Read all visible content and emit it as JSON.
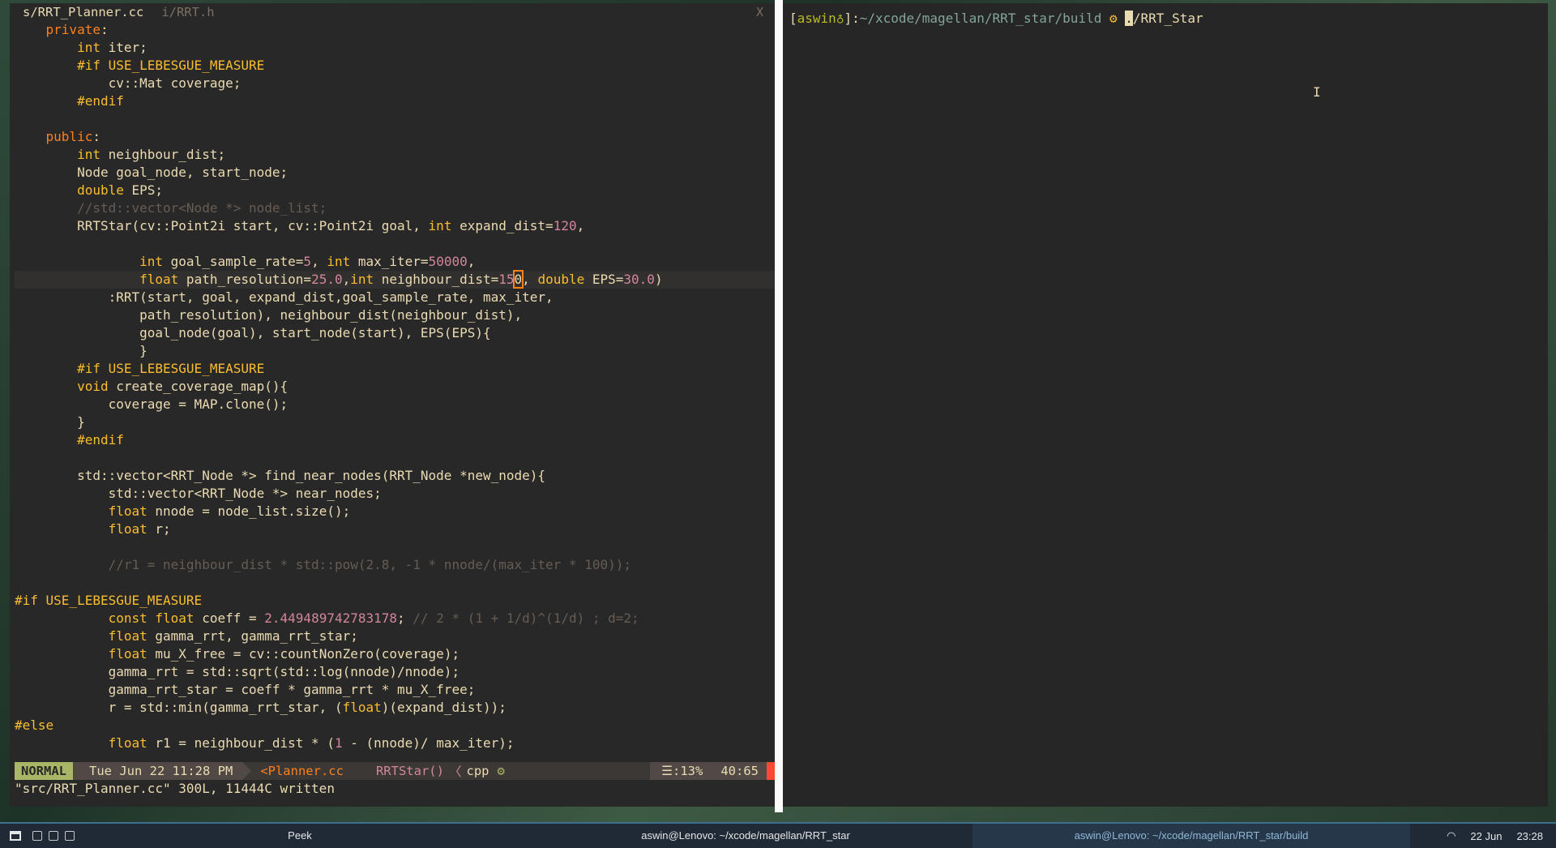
{
  "editor": {
    "tabs": [
      "s/RRT_Planner.cc",
      "i/RRT.h"
    ],
    "close_label": "X",
    "lines": [
      [
        [
          "    ",
          "t-fn"
        ],
        [
          "private",
          "t-kw"
        ],
        [
          ":",
          "t-fn"
        ]
      ],
      [
        [
          "        ",
          "t-fn"
        ],
        [
          "int",
          "t-type"
        ],
        [
          " iter;",
          "t-fn"
        ]
      ],
      [
        [
          "        ",
          "t-fn"
        ],
        [
          "#if USE_LEBESGUE_MEASURE",
          "t-pp"
        ]
      ],
      [
        [
          "            cv::Mat coverage;",
          "t-fn"
        ]
      ],
      [
        [
          "        ",
          "t-fn"
        ],
        [
          "#endif",
          "t-pp"
        ]
      ],
      [
        [
          "",
          "t-fn"
        ]
      ],
      [
        [
          "    ",
          "t-fn"
        ],
        [
          "public",
          "t-kw"
        ],
        [
          ":",
          "t-fn"
        ]
      ],
      [
        [
          "        ",
          "t-fn"
        ],
        [
          "int",
          "t-type"
        ],
        [
          " neighbour_dist;",
          "t-fn"
        ]
      ],
      [
        [
          "        Node goal_node, start_node;",
          "t-fn"
        ]
      ],
      [
        [
          "        ",
          "t-fn"
        ],
        [
          "double",
          "t-type"
        ],
        [
          " EPS;",
          "t-fn"
        ]
      ],
      [
        [
          "        //std::vector<Node *> node_list;",
          "t-cmt"
        ]
      ],
      [
        [
          "        RRTStar(cv::Point2i start, cv::Point2i goal, ",
          "t-fn"
        ],
        [
          "int",
          "t-type"
        ],
        [
          " expand_dist=",
          "t-fn"
        ],
        [
          "120",
          "t-num"
        ],
        [
          ",",
          "t-fn"
        ]
      ],
      [
        [
          "",
          "t-fn"
        ]
      ],
      [
        [
          "                ",
          "t-fn"
        ],
        [
          "int",
          "t-type"
        ],
        [
          " goal_sample_rate=",
          "t-fn"
        ],
        [
          "5",
          "t-num"
        ],
        [
          ", ",
          "t-fn"
        ],
        [
          "int",
          "t-type"
        ],
        [
          " max_iter=",
          "t-fn"
        ],
        [
          "50000",
          "t-num"
        ],
        [
          ",",
          "t-fn"
        ]
      ],
      [
        [
          "                ",
          "t-fn"
        ],
        [
          "float",
          "t-type"
        ],
        [
          " path_resolution=",
          "t-fn"
        ],
        [
          "25.0",
          "t-num"
        ],
        [
          ",",
          "t-fn"
        ],
        [
          "int",
          "t-type"
        ],
        [
          " neighbour_dist=",
          "t-fn"
        ],
        [
          "15",
          "t-num"
        ],
        [
          "0",
          "cur"
        ],
        [
          ", ",
          "t-fn"
        ],
        [
          "double",
          "t-type"
        ],
        [
          " EPS=",
          "t-fn"
        ],
        [
          "30.0",
          "t-num"
        ],
        [
          ")",
          "t-fn"
        ]
      ],
      [
        [
          "            :RRT(start, goal, expand_dist,goal_sample_rate, max_iter,",
          "t-fn"
        ]
      ],
      [
        [
          "                path_resolution), neighbour_dist(neighbour_dist),",
          "t-fn"
        ]
      ],
      [
        [
          "                goal_node(goal), start_node(start), EPS(EPS){",
          "t-fn"
        ]
      ],
      [
        [
          "                }",
          "t-fn"
        ]
      ],
      [
        [
          "        ",
          "t-fn"
        ],
        [
          "#if USE_LEBESGUE_MEASURE",
          "t-pp"
        ]
      ],
      [
        [
          "        ",
          "t-fn"
        ],
        [
          "void",
          "t-type"
        ],
        [
          " create_coverage_map(){",
          "t-fn"
        ]
      ],
      [
        [
          "            coverage = MAP.clone();",
          "t-fn"
        ]
      ],
      [
        [
          "        }",
          "t-fn"
        ]
      ],
      [
        [
          "        ",
          "t-fn"
        ],
        [
          "#endif",
          "t-pp"
        ]
      ],
      [
        [
          "",
          "t-fn"
        ]
      ],
      [
        [
          "        std::vector<RRT_Node *> find_near_nodes(RRT_Node *new_node){",
          "t-fn"
        ]
      ],
      [
        [
          "            std::vector<RRT_Node *> near_nodes;",
          "t-fn"
        ]
      ],
      [
        [
          "            ",
          "t-fn"
        ],
        [
          "float",
          "t-type"
        ],
        [
          " nnode = node_list.size();",
          "t-fn"
        ]
      ],
      [
        [
          "            ",
          "t-fn"
        ],
        [
          "float",
          "t-type"
        ],
        [
          " r;",
          "t-fn"
        ]
      ],
      [
        [
          "",
          "t-fn"
        ]
      ],
      [
        [
          "            //r1 = neighbour_dist * std::pow(2.8, -1 * nnode/(max_iter * 100));",
          "t-cmt"
        ]
      ],
      [
        [
          "",
          "t-fn"
        ]
      ],
      [
        [
          "#if USE_LEBESGUE_MEASURE",
          "t-pp"
        ]
      ],
      [
        [
          "            ",
          "t-fn"
        ],
        [
          "const float",
          "t-type"
        ],
        [
          " coeff = ",
          "t-fn"
        ],
        [
          "2.449489742783178",
          "t-num"
        ],
        [
          "; ",
          "t-fn"
        ],
        [
          "// 2 * (1 + 1/d)^(1/d) ; d=2;",
          "t-cmt"
        ]
      ],
      [
        [
          "            ",
          "t-fn"
        ],
        [
          "float",
          "t-type"
        ],
        [
          " gamma_rrt, gamma_rrt_star;",
          "t-fn"
        ]
      ],
      [
        [
          "            ",
          "t-fn"
        ],
        [
          "float",
          "t-type"
        ],
        [
          " mu_X_free = cv::countNonZero(coverage);",
          "t-fn"
        ]
      ],
      [
        [
          "            gamma_rrt = std::sqrt(std::log(nnode)/nnode);",
          "t-fn"
        ]
      ],
      [
        [
          "            gamma_rrt_star = coeff * gamma_rrt * mu_X_free;",
          "t-fn"
        ]
      ],
      [
        [
          "            r = std::min(gamma_rrt_star, (",
          "t-fn"
        ],
        [
          "float",
          "t-type"
        ],
        [
          ")(expand_dist));",
          "t-fn"
        ]
      ],
      [
        [
          "#else",
          "t-pp"
        ]
      ],
      [
        [
          "            ",
          "t-fn"
        ],
        [
          "float",
          "t-type"
        ],
        [
          " r1 = neighbour_dist * (",
          "t-fn"
        ],
        [
          "1",
          "t-num"
        ],
        [
          " - (nnode)/ max_iter);",
          "t-fn"
        ]
      ]
    ],
    "cursor_line_index": 14,
    "status": {
      "mode": "NORMAL",
      "datetime": "Tue Jun 22 11:28 PM",
      "file": "<Planner.cc",
      "function": "RRTStar()",
      "separator": "〈",
      "filetype": "cpp",
      "gear": "⚙",
      "percent": "☰:13%",
      "position": "40:65"
    },
    "message": "\"src/RRT_Planner.cc\" 300L, 11444C written"
  },
  "terminal": {
    "bracket_open": "[",
    "user": "aswin",
    "user_mark": "♁",
    "bracket_close": "]:",
    "path": "~/xcode/magellan/RRT_star/build",
    "git_mark": "⚙",
    "cursor_char": ".",
    "command_rest": "/RRT_Star",
    "ibeam": "I"
  },
  "taskbar": {
    "peek": "Peek",
    "task1": "aswin@Lenovo: ~/xcode/magellan/RRT_star",
    "task2": "aswin@Lenovo: ~/xcode/magellan/RRT_star/build",
    "wifi": "◠",
    "date": "22 Jun",
    "time": "23:28"
  },
  "colors": {
    "editor_bg": "#282828",
    "mode_bg": "#a9b665",
    "accent": "#fe8019",
    "taskbar_bg": "#1f2a36"
  }
}
